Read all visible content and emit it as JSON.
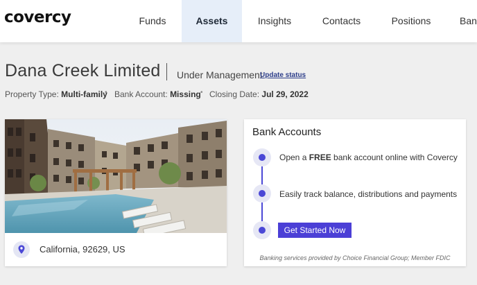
{
  "brand": {
    "logo": "covercy",
    "accent": "#4b3fd6"
  },
  "nav": {
    "items": [
      {
        "label": "Funds",
        "active": false
      },
      {
        "label": "Assets",
        "active": true
      },
      {
        "label": "Insights",
        "active": false
      },
      {
        "label": "Contacts",
        "active": false
      },
      {
        "label": "Positions",
        "active": false
      },
      {
        "label": "Ban",
        "active": false
      }
    ]
  },
  "header": {
    "title": "Dana Creek Limited",
    "status": "Under Management",
    "update_link": "Update status",
    "meta": {
      "property_type_label": "Property Type:",
      "property_type_value": "Multi-family",
      "bank_account_label": "Bank Account:",
      "bank_account_value": "Missing",
      "closing_date_label": "Closing Date:",
      "closing_date_value": "Jul 29, 2022",
      "separator": "•"
    }
  },
  "property": {
    "location": "California, 92629, US",
    "location_icon": "map-pin-icon"
  },
  "bank_accounts": {
    "title": "Bank Accounts",
    "step1_prefix": "Open a ",
    "step1_bold": "FREE",
    "step1_suffix": " bank account online with Covercy",
    "step2": "Easily track balance, distributions and payments",
    "cta": "Get Started Now",
    "disclaimer": "Banking services provided by Choice Financial Group; Member FDIC"
  }
}
